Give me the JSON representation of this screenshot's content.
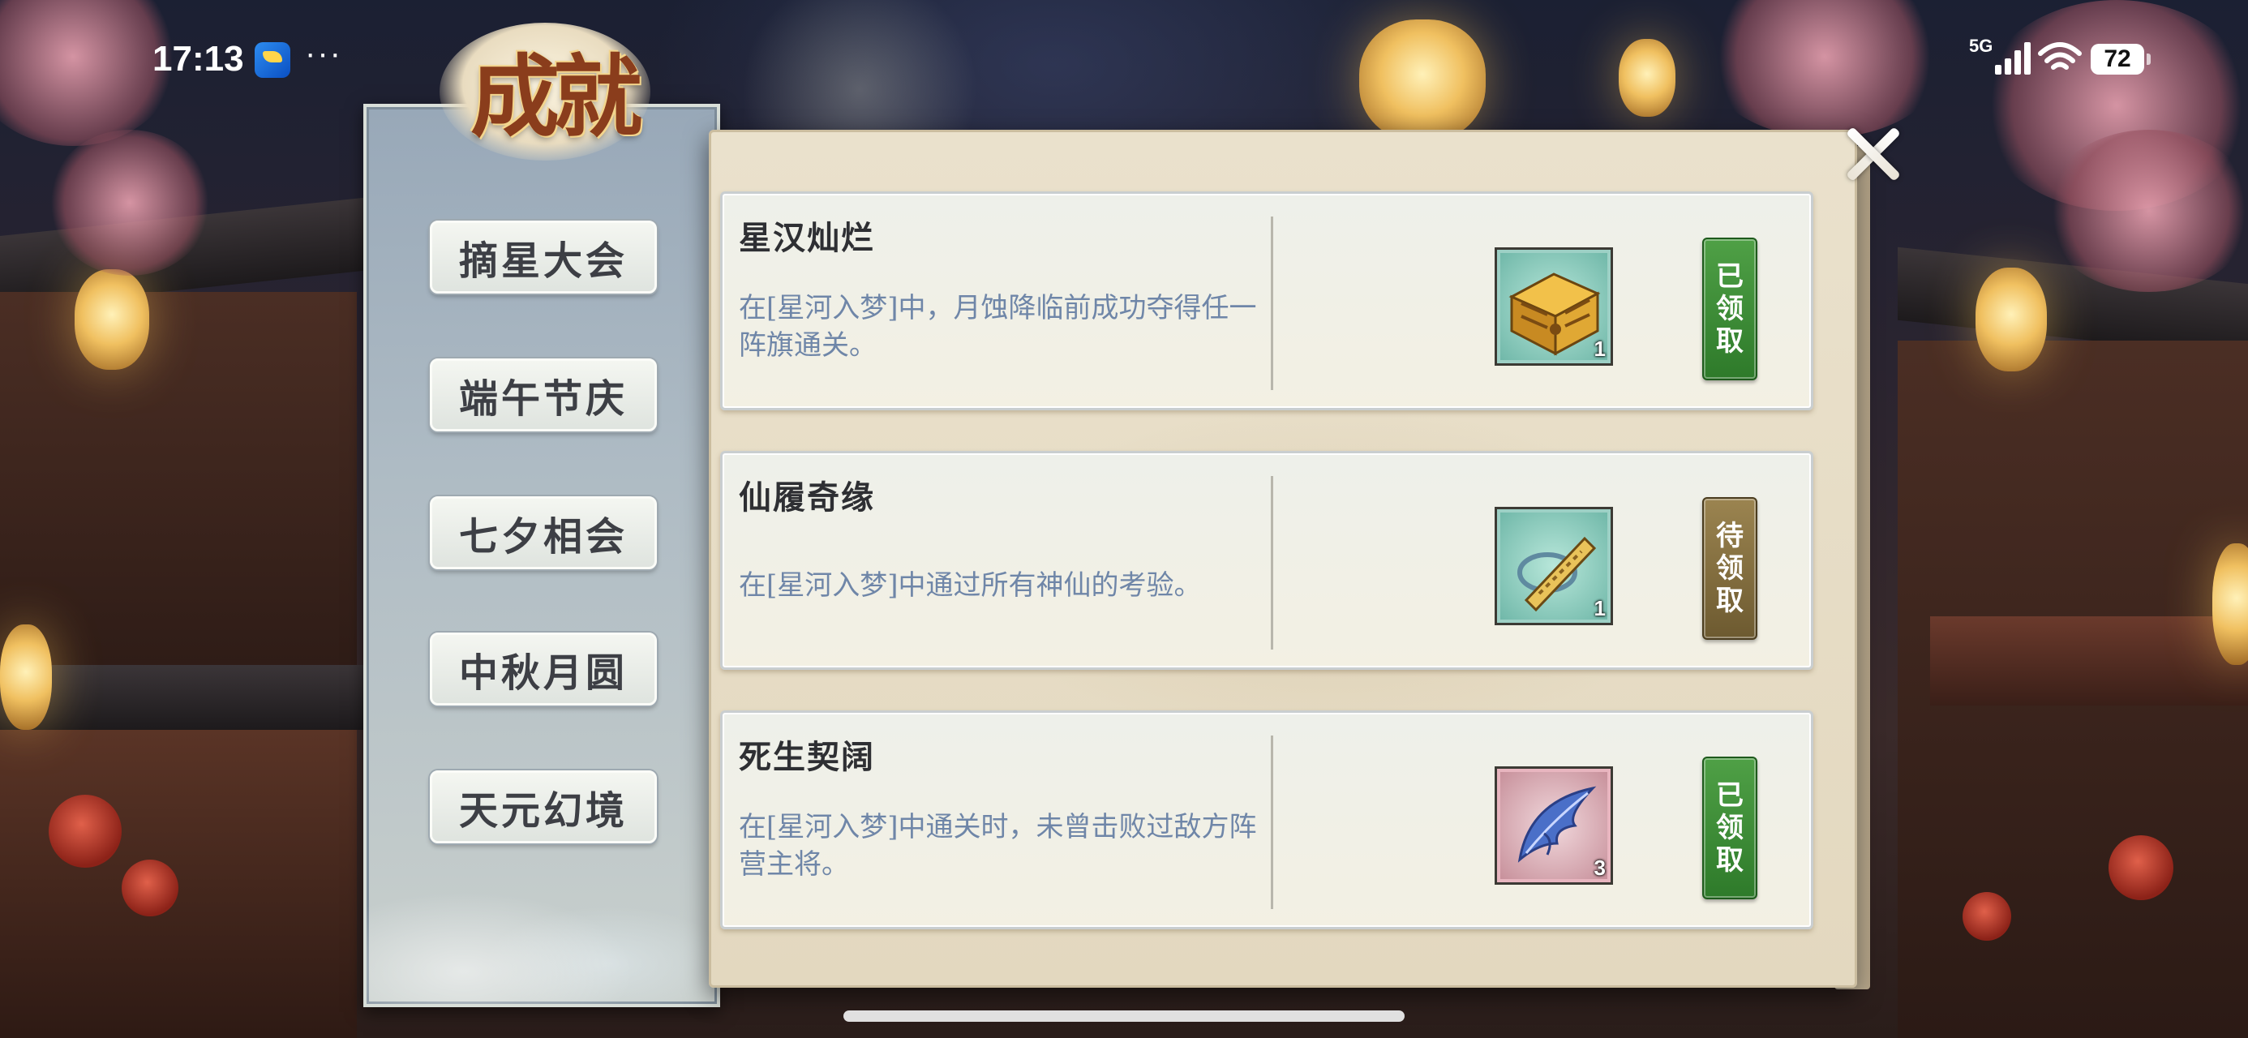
{
  "status_bar": {
    "time": "17:13",
    "more": "···",
    "network": "5G",
    "battery": "72"
  },
  "title": "成就",
  "sidebar": {
    "items": [
      {
        "label": "摘星大会"
      },
      {
        "label": "端午节庆"
      },
      {
        "label": "七夕相会"
      },
      {
        "label": "中秋月圆"
      },
      {
        "label": "天元幻境"
      }
    ]
  },
  "achievements": [
    {
      "title": "星汉灿烂",
      "description": "在[星河入梦]中，月蚀降临前成功夺得任一阵旗通关。",
      "reward_icon": "treasure-chest-icon",
      "reward_qty": "1",
      "status_label": [
        "已",
        "领",
        "取"
      ],
      "status": "claimed"
    },
    {
      "title": "仙履奇缘",
      "description": "在[星河入梦]中通过所有神仙的考验。",
      "reward_icon": "scroll-token-icon",
      "reward_qty": "1",
      "status_label": [
        "待",
        "领",
        "取"
      ],
      "status": "pending"
    },
    {
      "title": "死生契阔",
      "description": "在[星河入梦]中通关时，未曾击败过敌方阵营主将。",
      "reward_icon": "phoenix-feather-icon",
      "reward_qty": "3",
      "status_label": [
        "已",
        "领",
        "取"
      ],
      "status": "claimed"
    }
  ],
  "colors": {
    "claimed": "#3f8f38",
    "pending": "#8a744a",
    "desc_text": "#6f86a8"
  }
}
